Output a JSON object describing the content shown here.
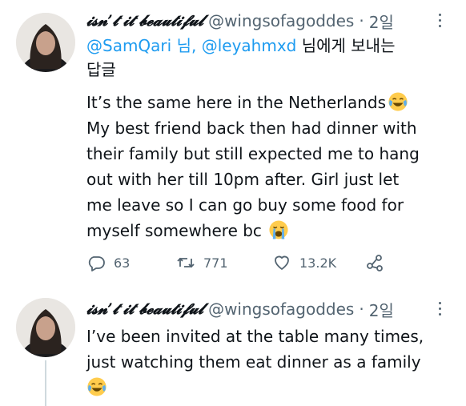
{
  "tweets": [
    {
      "display_name": "𝓲𝓼𝓷’𝓽 𝓲𝓽 𝓫𝓮𝓪𝓾𝓽𝓲𝓯𝓾𝓵",
      "handle": "@wingsofagoddes",
      "separator": "·",
      "time": "2일",
      "reply_to": {
        "user1": "@SamQari",
        "sep1": " 님, ",
        "user2": "@leyahmxd",
        "suffix": " 님에게 보내는",
        "suffix2": "답글"
      },
      "lines": [
        "It’s the same here in the Netherlands",
        "My best friend back then had dinner with",
        "their family but still expected me to hang",
        "out with her till 10pm after. Girl just let",
        "me leave so I can go buy some food for",
        "myself somewhere bc"
      ],
      "emojis": [
        "face-with-tears-of-joy-emoji",
        "loudly-crying-face-emoji"
      ],
      "actions": {
        "replies": "63",
        "retweets": "771",
        "likes": "13.2K"
      },
      "icons": [
        "reply-icon",
        "retweet-icon",
        "like-icon",
        "share-icon",
        "more-icon"
      ]
    },
    {
      "display_name": "𝓲𝓼𝓷’𝓽 𝓲𝓽 𝓫𝓮𝓪𝓾𝓽𝓲𝓯𝓾𝓵",
      "handle": "@wingsofagoddes",
      "separator": "·",
      "time": "2일",
      "lines": [
        "I’ve been invited at the table many times,",
        "just watching them eat dinner as a family"
      ],
      "emojis": [
        "face-with-tears-of-joy-emoji"
      ]
    }
  ],
  "colors": {
    "text": "#0f1419",
    "secondary": "#536471",
    "link": "#1d9bf0",
    "thread_line": "#cfd9de"
  }
}
